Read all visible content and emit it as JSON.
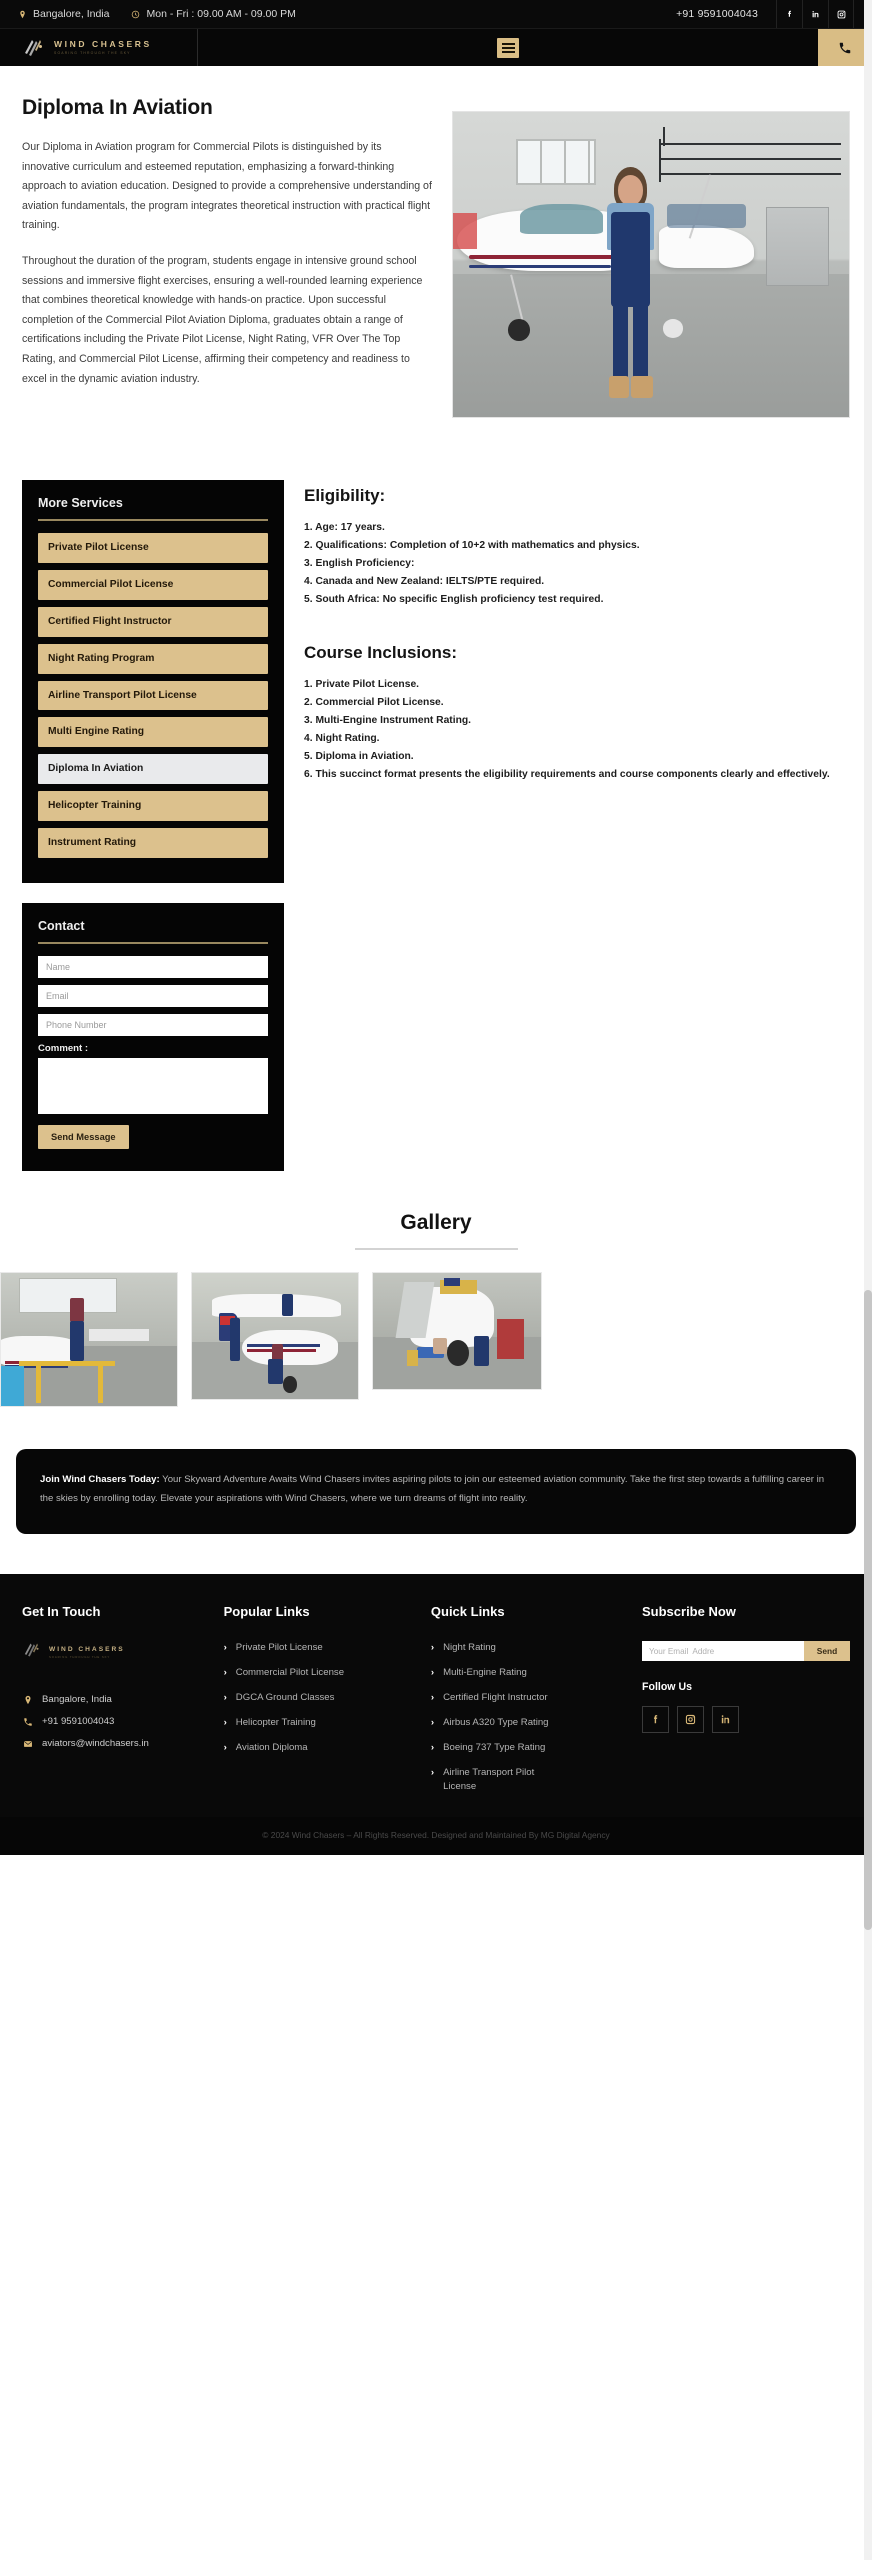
{
  "topbar": {
    "location": "Bangalore, India",
    "hours": "Mon - Fri : 09.00 AM - 09.00 PM",
    "phone": "+91 9591004043",
    "socials": [
      "facebook-icon",
      "linkedin-icon",
      "instagram-icon"
    ]
  },
  "header": {
    "logo_name": "WIND CHASERS",
    "logo_tagline": "SOARING THROUGH THE SKY",
    "menu_icon": "hamburger-icon",
    "phone_icon": "phone-icon"
  },
  "hero": {
    "title": "Diploma In Aviation",
    "paragraph1": "Our Diploma in Aviation program for Commercial Pilots is distinguished by its innovative curriculum and esteemed reputation, emphasizing a forward-thinking approach to aviation education. Designed to provide a comprehensive understanding of aviation fundamentals, the program integrates theoretical instruction with practical flight training.",
    "paragraph2": "Throughout the duration of the program, students engage in intensive ground school sessions and immersive flight exercises, ensuring a well-rounded learning experience that combines theoretical knowledge with hands-on practice. Upon successful completion of the Commercial Pilot Aviation Diploma, graduates obtain a range of certifications including the Private Pilot License, Night Rating, VFR Over The Top Rating, and Commercial Pilot License, affirming their competency and readiness to excel in the dynamic aviation industry.",
    "image_alt": "female-aviation-technician-beside-aircraft-in-hangar"
  },
  "services": {
    "title": "More Services",
    "items": [
      {
        "label": "Private Pilot License",
        "active": false
      },
      {
        "label": "Commercial Pilot License",
        "active": false
      },
      {
        "label": "Certified Flight Instructor",
        "active": false
      },
      {
        "label": "Night Rating Program",
        "active": false
      },
      {
        "label": "Airline Transport Pilot License",
        "active": false
      },
      {
        "label": "Multi Engine Rating",
        "active": false
      },
      {
        "label": "Diploma In Aviation",
        "active": true
      },
      {
        "label": "Helicopter Training",
        "active": false
      },
      {
        "label": "Instrument Rating",
        "active": false
      }
    ]
  },
  "eligibility": {
    "title": "Eligibility:",
    "items": [
      "1. Age: 17 years.",
      "2. Qualifications: Completion of 10+2 with mathematics and physics.",
      "3. English Proficiency:",
      "4. Canada and New Zealand: IELTS/PTE required.",
      "5. South Africa: No specific English proficiency test required."
    ]
  },
  "course_inclusions": {
    "title": "Course Inclusions:",
    "items": [
      "1. Private Pilot License.",
      "2. Commercial Pilot License.",
      "3. Multi-Engine Instrument Rating.",
      "4. Night Rating.",
      "5. Diploma in Aviation.",
      "6. This succinct format presents the eligibility requirements and course components clearly and effectively."
    ]
  },
  "contact": {
    "title": "Contact",
    "name_placeholder": "Name",
    "email_placeholder": "Email",
    "phone_placeholder": "Phone Number",
    "comment_label": "Comment :",
    "comment_value": "",
    "submit_label": "Send Message"
  },
  "gallery": {
    "title": "Gallery",
    "images": [
      "technician-on-yellow-platform-servicing-aircraft-propeller",
      "students-inspecting-small-plane-wing-in-hangar",
      "crew-working-under-cessna-aircraft-in-hangar"
    ]
  },
  "cta": {
    "lead": "Join Wind Chasers Today:",
    "body": " Your Skyward Adventure Awaits Wind Chasers invites aspiring pilots to join our esteemed aviation community. Take the first step towards a fulfilling career in the skies by enrolling today. Elevate your aspirations with Wind Chasers, where we turn dreams of flight into reality."
  },
  "footer": {
    "get_in_touch": {
      "title": "Get In Touch",
      "logo_name": "WIND CHASERS",
      "logo_tagline": "SOARING THROUGH THE SKY",
      "address": "Bangalore, India",
      "phone": "+91 9591004043",
      "email": "aviators@windchasers.in"
    },
    "popular_links": {
      "title": "Popular Links",
      "items": [
        "Private Pilot License",
        "Commercial Pilot License",
        "DGCA Ground Classes",
        "Helicopter Training",
        "Aviation Diploma"
      ]
    },
    "quick_links": {
      "title": "Quick Links",
      "items": [
        "Night Rating",
        "Multi-Engine Rating",
        "Certified Flight Instructor",
        "Airbus A320 Type Rating",
        "Boeing 737 Type Rating",
        "Airline Transport Pilot License"
      ]
    },
    "subscribe": {
      "title": "Subscribe Now",
      "email_placeholder": "Your Email  Addre",
      "button_label": "Send",
      "follow_title": "Follow Us",
      "socials": [
        "facebook-icon",
        "instagram-icon",
        "linkedin-icon"
      ]
    },
    "copyright": "© 2024 Wind Chasers – All Rights Reserved. Designed and Maintained By MG Digital Agency"
  },
  "colors": {
    "gold": "#dcc18d",
    "dark": "#070707",
    "topbar_accent": "#d9b877"
  }
}
